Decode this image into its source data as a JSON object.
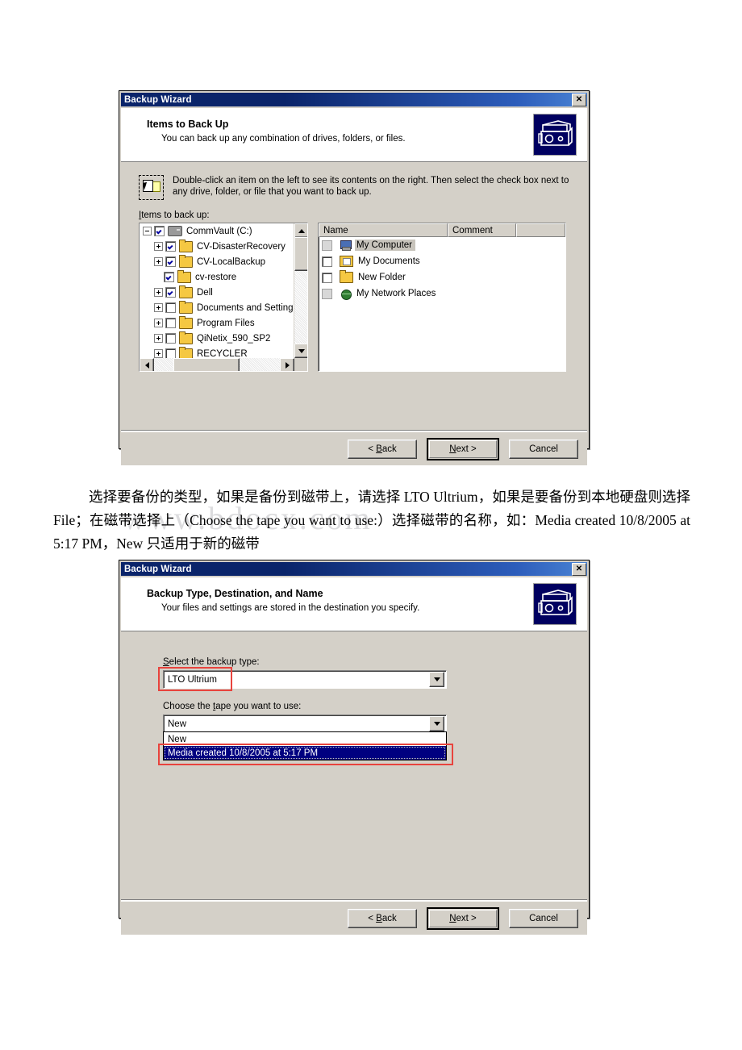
{
  "watermark": "www.bdocx.com",
  "paragraph": {
    "line1": "选择要备份的类型，如果是备份到磁带上，请选择 LTO Ultrium，如果是要备份到",
    "line2": "本地硬盘则选择 File；在磁带选择上（Choose the tape you want to use:）选择磁带的名",
    "line3": "称，如：Media created 10/8/2005 at 5:17 PM，New 只适用于新的磁带"
  },
  "dialog1": {
    "title": "Backup Wizard",
    "close_label": "✕",
    "banner": {
      "heading": "Items to Back Up",
      "subheading": "You can back up any combination of drives, folders, or files.",
      "icon": "tape-backup-icon"
    },
    "hint": "Double-click an item on the left to see its contents on the right. Then select the check box next to any drive, folder, or file that you want to back up.",
    "items_label": "Items to back up:",
    "tree": [
      {
        "label": "CommVault (C:)",
        "depth": 0,
        "expander": "minus",
        "checked": true,
        "icon": "drive-icon"
      },
      {
        "label": "CV-DisasterRecovery",
        "depth": 1,
        "expander": "plus",
        "checked": true,
        "icon": "folder-icon"
      },
      {
        "label": "CV-LocalBackup",
        "depth": 1,
        "expander": "plus",
        "checked": true,
        "icon": "folder-icon"
      },
      {
        "label": "cv-restore",
        "depth": 1,
        "expander": "none",
        "checked": true,
        "icon": "folder-icon"
      },
      {
        "label": "Dell",
        "depth": 1,
        "expander": "plus",
        "checked": true,
        "icon": "folder-icon"
      },
      {
        "label": "Documents and Settings",
        "depth": 1,
        "expander": "plus",
        "checked": false,
        "icon": "folder-icon"
      },
      {
        "label": "Program Files",
        "depth": 1,
        "expander": "plus",
        "checked": false,
        "icon": "folder-icon"
      },
      {
        "label": "QiNetix_590_SP2",
        "depth": 1,
        "expander": "plus",
        "checked": false,
        "icon": "folder-icon"
      },
      {
        "label": "RECYCLER",
        "depth": 1,
        "expander": "plus",
        "checked": false,
        "icon": "folder-icon"
      }
    ],
    "list_columns": [
      "Name",
      "Comment"
    ],
    "list_rows": [
      {
        "name": "My Computer",
        "comment": "",
        "checkbox": "dim",
        "icon": "computer-icon",
        "selected": true
      },
      {
        "name": "My Documents",
        "comment": "",
        "checkbox": "empty",
        "icon": "my-documents-icon",
        "selected": false
      },
      {
        "name": "New Folder",
        "comment": "",
        "checkbox": "empty",
        "icon": "folder-icon",
        "selected": false
      },
      {
        "name": "My Network Places",
        "comment": "",
        "checkbox": "dim",
        "icon": "network-icon",
        "selected": false
      }
    ],
    "buttons": {
      "back": "< Back",
      "back_u": "B",
      "next": "Next >",
      "next_u": "N",
      "cancel": "Cancel"
    }
  },
  "dialog2": {
    "title": "Backup Wizard",
    "close_label": "✕",
    "banner": {
      "heading": "Backup Type, Destination, and Name",
      "subheading": "Your files and settings are stored in the destination you specify.",
      "icon": "tape-backup-icon"
    },
    "backup_type_label": "Select the backup type:",
    "backup_type_value": "LTO Ultrium",
    "tape_label": "Choose the tape you want to use:",
    "tape_value": "New",
    "tape_options": [
      {
        "label": "New",
        "selected": false
      },
      {
        "label": "Media created 10/8/2005 at 5:17 PM",
        "selected": true
      }
    ],
    "buttons": {
      "back": "< Back",
      "back_u": "B",
      "next": "Next >",
      "next_u": "N",
      "cancel": "Cancel"
    },
    "highlight_color": "#e8433d"
  }
}
